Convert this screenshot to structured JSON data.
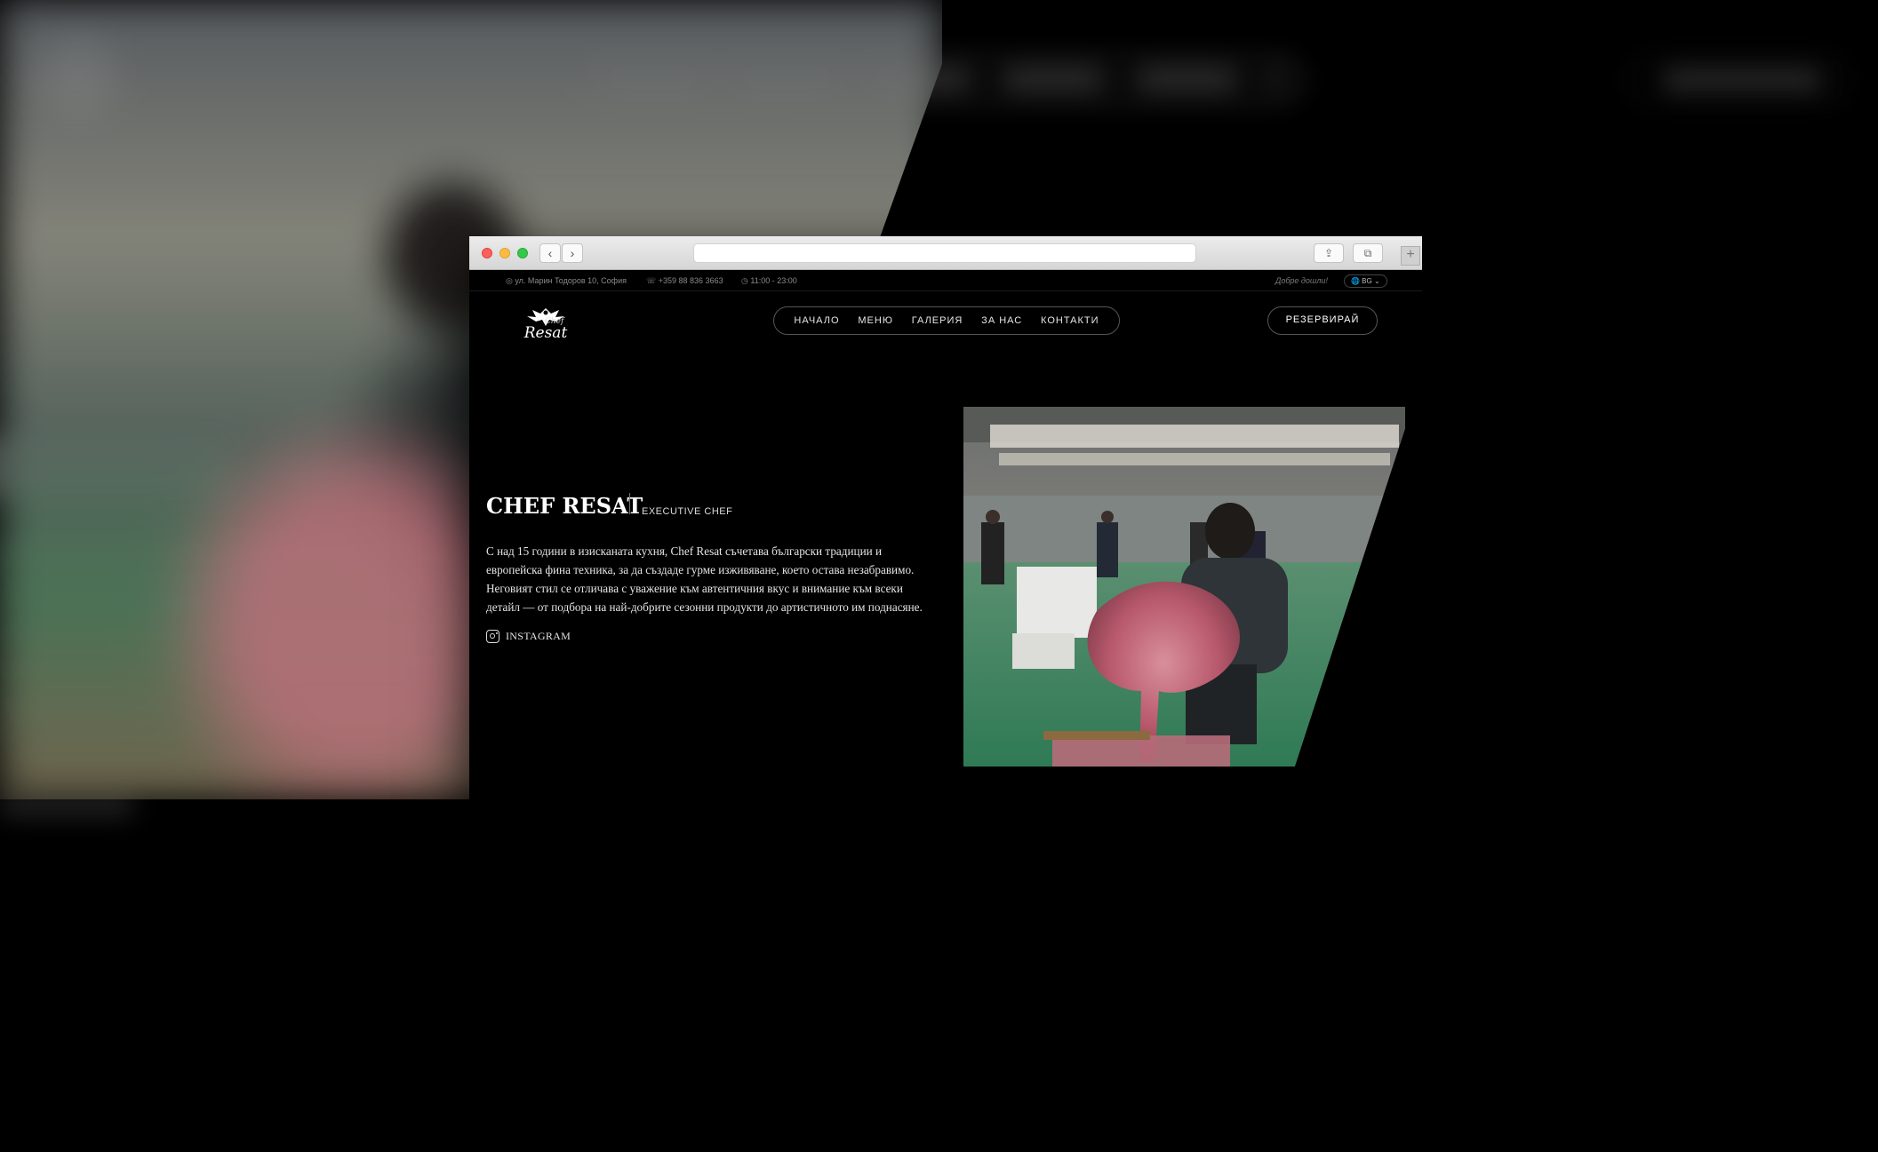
{
  "browser": {
    "back_glyph": "‹",
    "forward_glyph": "›",
    "share_glyph": "⇪",
    "tabs_glyph": "⧉",
    "new_tab_glyph": "+"
  },
  "topbar": {
    "address": "◎ ул. Марин Тодоров 10, София",
    "phone": "☏ +359 88 836 3663",
    "hours": "◷ 11:00 - 23:00",
    "welcome": "Добре дошли!",
    "language": "🌐 BG ⌄"
  },
  "logo": {
    "chef": "Chef",
    "script": "Resat"
  },
  "nav": {
    "items": [
      "НАЧАЛО",
      "МЕНЮ",
      "ГАЛЕРИЯ",
      "ЗА НАС",
      "КОНТАКТИ"
    ]
  },
  "reserve_label": "РЕЗЕРВИРАЙ",
  "chef": {
    "name": "CHEF RESAT",
    "role": "EXECUTIVE CHEF",
    "bio": "С над 15 години в изисканата кухня, Chef Resat съчетава български традиции и европейска фина техника, за да създаде гурме изживяване, което остава незабравимо. Неговият стил се отличава с уважение към автентичния вкус и внимание към всеки детайл — от подбора на най-добрите сезонни продукти до артистичното им поднасяне.",
    "instagram_label": "INSTAGRAM"
  },
  "colors": {
    "page_bg": "#000000",
    "text": "#ffffff",
    "muted": "#8a8a8a",
    "border": "#555555"
  }
}
